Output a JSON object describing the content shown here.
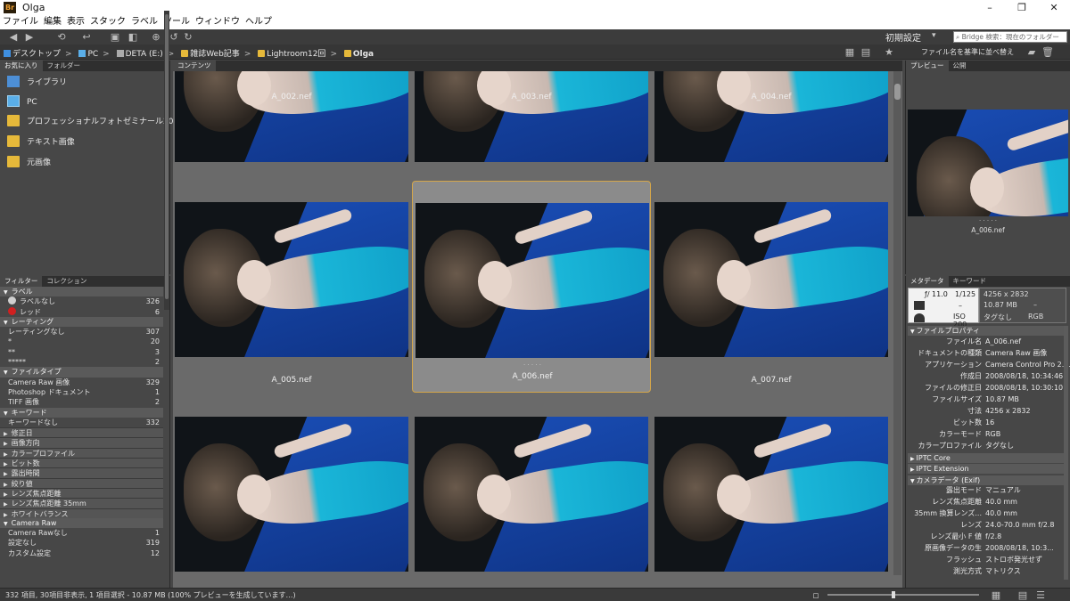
{
  "window": {
    "logo": "Br",
    "title": "Olga",
    "minimize": "–",
    "maximize": "❐",
    "close": "✕"
  },
  "menu": [
    "ファイル",
    "編集",
    "表示",
    "スタック",
    "ラベル",
    "ツール",
    "ウィンドウ",
    "ヘルプ"
  ],
  "toolbar": {
    "workspace": "初期設定",
    "search_placeholder": "⌕ Bridge 検索：現在のフォルダー"
  },
  "breadcrumb": [
    "デスクトップ",
    "PC",
    "DETA (E:)",
    "雑誌Web記事",
    "Lightroom12回",
    "Olga"
  ],
  "sort_label": "ファイル名を基準に並べ替え",
  "left_top_tabs": [
    "お気に入り",
    "フォルダー"
  ],
  "favorites": [
    {
      "label": "ライブラリ",
      "icon": "library-icon"
    },
    {
      "label": "PC",
      "icon": "pc-icon"
    },
    {
      "label": "プロフェッショナルフォトゼミナール2017テキ",
      "icon": "folder-icon"
    },
    {
      "label": "テキスト画像",
      "icon": "folder-icon"
    },
    {
      "label": "元画像",
      "icon": "folder-icon"
    }
  ],
  "left_bottom_tabs": [
    "フィルター",
    "コレクション"
  ],
  "filters": [
    {
      "type": "head",
      "label": "ラベル"
    },
    {
      "type": "sub",
      "label": "ラベルなし",
      "count": "326",
      "dot": "#cfcfcf"
    },
    {
      "type": "sub",
      "label": "レッド",
      "count": "6",
      "dot": "#d02020"
    },
    {
      "type": "head",
      "label": "レーティング"
    },
    {
      "type": "sub",
      "label": "レーティングなし",
      "count": "307"
    },
    {
      "type": "sub",
      "label": "*",
      "count": "20"
    },
    {
      "type": "sub",
      "label": "**",
      "count": "3"
    },
    {
      "type": "sub",
      "label": "*****",
      "count": "2"
    },
    {
      "type": "head",
      "label": "ファイルタイプ"
    },
    {
      "type": "sub",
      "label": "Camera Raw 画像",
      "count": "329"
    },
    {
      "type": "sub",
      "label": "Photoshop ドキュメント",
      "count": "1"
    },
    {
      "type": "sub",
      "label": "TIFF 画像",
      "count": "2"
    },
    {
      "type": "head",
      "label": "キーワード"
    },
    {
      "type": "sub",
      "label": "キーワードなし",
      "count": "332"
    },
    {
      "type": "coll",
      "label": "修正日"
    },
    {
      "type": "coll",
      "label": "画像方向"
    },
    {
      "type": "coll",
      "label": "カラープロファイル"
    },
    {
      "type": "coll",
      "label": "ビット数"
    },
    {
      "type": "coll",
      "label": "露出時間"
    },
    {
      "type": "coll",
      "label": "絞り値"
    },
    {
      "type": "coll",
      "label": "レンズ焦点距離"
    },
    {
      "type": "coll",
      "label": "レンズ焦点距離 35mm"
    },
    {
      "type": "coll",
      "label": "ホワイトバランス"
    },
    {
      "type": "head",
      "label": "Camera Raw"
    },
    {
      "type": "sub",
      "label": "Camera Rawなし",
      "count": "1"
    },
    {
      "type": "sub",
      "label": "設定なし",
      "count": "319"
    },
    {
      "type": "sub",
      "label": "カスタム設定",
      "count": "12"
    }
  ],
  "content_tab": "コンテンツ",
  "thumbnails": [
    "A_002.nef",
    "A_003.nef",
    "A_004.nef",
    "A_005.nef",
    "A_006.nef",
    "A_007.nef",
    "",
    "",
    ""
  ],
  "selected_dots": "· · · · ·",
  "right_top_tabs": [
    "プレビュー",
    "公開"
  ],
  "preview": {
    "name": "A_006.nef",
    "dots": "· · · · ·"
  },
  "right_bottom_tabs": [
    "メタデータ",
    "キーワード"
  ],
  "meta_box": {
    "fstop": "ƒ/ 11.0",
    "shutter": "1/125",
    "dash": "–",
    "iso": "ISO 200",
    "dims": "4256 x 2832",
    "size": "10.87 MB",
    "dash2": "–",
    "tag": "タグなし",
    "mode": "RGB"
  },
  "file_props_head": "ファイルプロパティ",
  "file_props": [
    {
      "k": "ファイル名",
      "v": "A_006.nef"
    },
    {
      "k": "ドキュメントの種類",
      "v": "Camera Raw 画像"
    },
    {
      "k": "アプリケーション",
      "v": "Camera Control Pro 2...."
    },
    {
      "k": "作成日",
      "v": "2008/08/18, 10:34:46"
    },
    {
      "k": "ファイルの修正日",
      "v": "2008/08/18, 10:30:10"
    },
    {
      "k": "ファイルサイズ",
      "v": "10.87 MB"
    },
    {
      "k": "寸法",
      "v": "4256 x 2832"
    },
    {
      "k": "ビット数",
      "v": "16"
    },
    {
      "k": "カラーモード",
      "v": "RGB"
    },
    {
      "k": "カラープロファイル",
      "v": "タグなし"
    }
  ],
  "iptc_core": "IPTC Core",
  "iptc_ext": "IPTC Extension",
  "exif_head": "カメラデータ (Exif)",
  "exif": [
    {
      "k": "露出モード",
      "v": "マニュアル"
    },
    {
      "k": "レンズ焦点距離",
      "v": "40.0 mm"
    },
    {
      "k": "35mm 換算レンズ...",
      "v": "40.0 mm"
    },
    {
      "k": "レンズ",
      "v": "24.0-70.0 mm f/2.8"
    },
    {
      "k": "レンズ最小 F 値",
      "v": "f/2.8"
    },
    {
      "k": "原画像データの生",
      "v": "2008/08/18, 10:3..."
    },
    {
      "k": "フラッシュ",
      "v": "ストロボ発光せず"
    },
    {
      "k": "測光方式",
      "v": "マトリクス"
    }
  ],
  "status": "332 項目, 30項目非表示, 1 項目選択 - 10.87 MB (100% プレビューを生成しています…)",
  "colors": {
    "accent": "#d4a64a",
    "folder": "#e6b93a"
  }
}
